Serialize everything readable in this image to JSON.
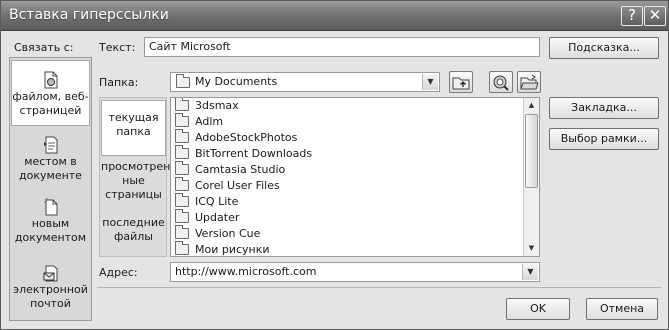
{
  "window": {
    "title": "Вставка гиперссылки",
    "help_button": "?",
    "close_button": "✕"
  },
  "link_to": {
    "label": "Связать с:",
    "items": [
      {
        "label_line1": "файлом, веб-",
        "label_line2": "страницей",
        "icon": "web-page-icon",
        "selected": true
      },
      {
        "label_line1": "местом в",
        "label_line2": "документе",
        "icon": "place-in-document-icon",
        "selected": false
      },
      {
        "label_line1": "новым",
        "label_line2": "документом",
        "icon": "new-document-icon",
        "selected": false
      },
      {
        "label_line1": "электронной",
        "label_line2": "почтой",
        "icon": "email-icon",
        "selected": false
      }
    ]
  },
  "text_field": {
    "label": "Текст:",
    "value": "Сайт Microsoft"
  },
  "folder": {
    "label": "Папка:",
    "value": "My Documents"
  },
  "browse": {
    "items": [
      {
        "line1": "текущая",
        "line2": "папка",
        "line3": "",
        "selected": true
      },
      {
        "line1": "просмотрен-",
        "line2": "ные",
        "line3": "страницы",
        "selected": false
      },
      {
        "line1": "последние",
        "line2": "файлы",
        "line3": "",
        "selected": false
      }
    ]
  },
  "files": [
    "3dsmax",
    "Adlm",
    "AdobeStockPhotos",
    "BitTorrent Downloads",
    "Camtasia Studio",
    "Corel User Files",
    "ICQ Lite",
    "Updater",
    "Version Cue",
    "Мои рисунки"
  ],
  "address": {
    "label": "Адрес:",
    "value": "http://www.microsoft.com"
  },
  "buttons": {
    "tooltip": "Подсказка...",
    "bookmark": "Закладка...",
    "frame": "Выбор рамки...",
    "ok": "OK",
    "cancel": "Отмена"
  }
}
